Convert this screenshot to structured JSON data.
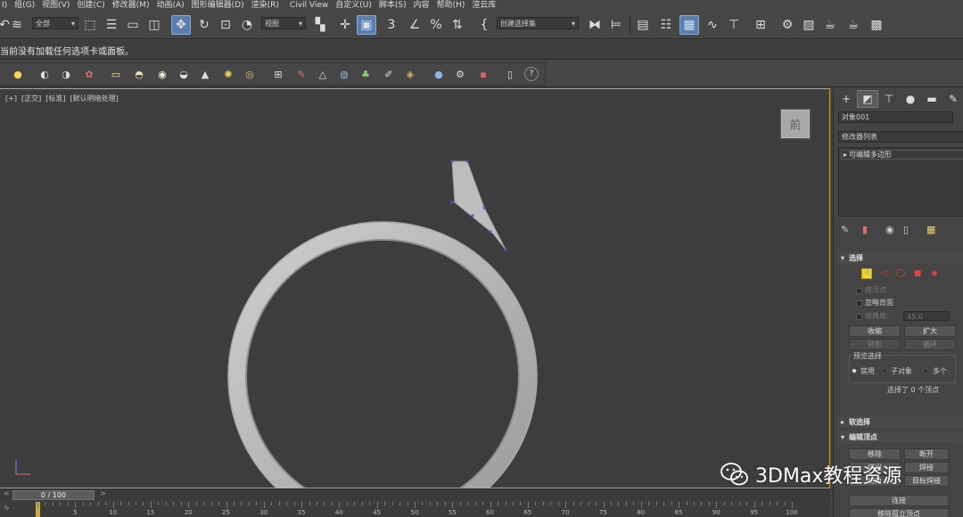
{
  "menu": {
    "items": [
      "I)",
      "组(G)",
      "视图(V)",
      "创建(C)",
      "修改器(M)",
      "动画(A)",
      "图形编辑器(D)",
      "渲染(R)",
      "Civil View",
      "自定义(U)",
      "脚本(S)",
      "内容",
      "帮助(H)",
      "渲云库"
    ]
  },
  "toolbar": {
    "filter_select": "全部",
    "coord_select": "视图",
    "named_selection_select": "创建选择集"
  },
  "prompt": {
    "text": "当前没有加载任何选项卡或面板。"
  },
  "viewport": {
    "labels": [
      "[+]",
      "[正交]",
      "[标准]",
      "[默认明暗处理]"
    ],
    "viewcube_label": "前"
  },
  "command_panel": {
    "object_name": "对象001",
    "modifier_list_label": "修改器列表",
    "stack_item": "可编辑多边形",
    "selection_rollout": "选择",
    "by_vertex": "按顶点",
    "ignore_backfacing": "忽略背面",
    "by_angle_label": "按角度:",
    "by_angle_value": "45.0",
    "shrink": "收缩",
    "grow": "扩大",
    "ring": "环形",
    "loop": "循环",
    "preview_selection_title": "预览选择",
    "preview_options": [
      "禁用",
      "子对象",
      "多个"
    ],
    "selection_status": "选择了 0 个顶点",
    "soft_selection_rollout": "软选择",
    "edit_vertices_rollout": "编辑顶点",
    "remove": "移除",
    "break": "断开",
    "extrude": "挤出",
    "weld": "焊接",
    "chamfer": "切角",
    "target_weld": "目标焊接",
    "connect": "连接",
    "remove_isolated": "移除孤立顶点"
  },
  "time_slider": {
    "position": "0 / 100",
    "prev_arrow": "<",
    "next_arrow": ">"
  },
  "timeline": {
    "ticks": [
      "0",
      "5",
      "10",
      "15",
      "20",
      "25",
      "30",
      "35",
      "40",
      "45",
      "50",
      "55",
      "60",
      "65",
      "70",
      "75",
      "80",
      "85",
      "90",
      "95",
      "100"
    ]
  },
  "watermark": {
    "text": "3DMax教程资源"
  },
  "colors": {
    "viewport_border": "#c6a43c",
    "vertex_color": "#4a5bd6",
    "ring_color": "#b9b9b9"
  }
}
